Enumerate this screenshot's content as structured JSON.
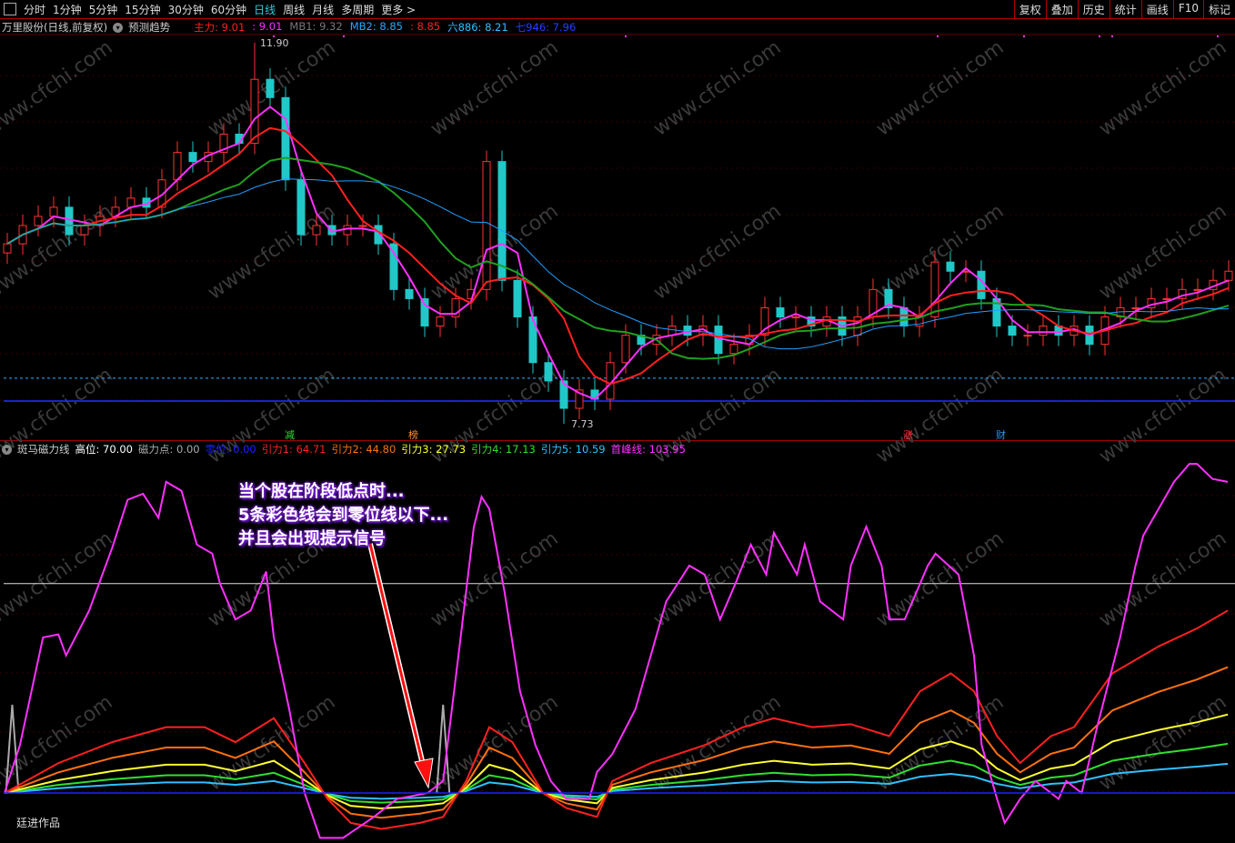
{
  "toolbar": {
    "periods": [
      "分时",
      "1分钟",
      "5分钟",
      "15分钟",
      "30分钟",
      "60分钟",
      "日线",
      "周线",
      "月线",
      "多周期",
      "更多 >"
    ],
    "active": "日线",
    "right": [
      "复权",
      "叠加",
      "历史",
      "统计",
      "画线",
      "F10",
      "标记"
    ]
  },
  "main_legend": {
    "title": "万里股份(日线,前复权)",
    "forecast": "预测趋势",
    "items": [
      {
        "label": "主力: 9.01",
        "color": "#ff2020"
      },
      {
        "label": ": 9.01",
        "color": "#ff30ff"
      },
      {
        "label": "MB1: 9.32",
        "color": "#777777"
      },
      {
        "label": "MB2: 8.85",
        "color": "#20aaff"
      },
      {
        "label": ": 8.85",
        "color": "#ff2020"
      },
      {
        "label": "六886: 8.21",
        "color": "#30c0ff"
      },
      {
        "label": "七946: 7.96",
        "color": "#2040ff"
      }
    ]
  },
  "ind_legend": {
    "title": "斑马磁力线",
    "items": [
      {
        "label": "高位: 70.00",
        "color": "#ffffff"
      },
      {
        "label": "磁力点: 0.00",
        "color": "#aaaaaa"
      },
      {
        "label": "零位: 0.00",
        "color": "#2020ff"
      },
      {
        "label": "引力1: 64.71",
        "color": "#ff2020"
      },
      {
        "label": "引力2: 44.80",
        "color": "#ff7010"
      },
      {
        "label": "引力3: 27.73",
        "color": "#ffff30"
      },
      {
        "label": "引力4: 17.13",
        "color": "#30e030"
      },
      {
        "label": "引力5: 10.59",
        "color": "#30c0ff"
      },
      {
        "label": "首峰线: 103.95",
        "color": "#ff30ff"
      }
    ]
  },
  "annotation": [
    "当个股在阶段低点时...",
    "5条彩色线会到零位线以下...",
    "并且会出现提示信号"
  ],
  "footer": "廷进作品",
  "watermark": "www.cfchi.com",
  "markers": [
    {
      "label": "减",
      "bar": 37,
      "color": "#30e030"
    },
    {
      "label": "榜",
      "bar": 53,
      "color": "#ff9030"
    },
    {
      "label": "涨",
      "bar": 117,
      "color": "#ff3030"
    },
    {
      "label": "财",
      "bar": 129,
      "color": "#3090ff"
    }
  ],
  "chart_data": [
    {
      "type": "candlestick",
      "title": "万里股份(日线,前复权)",
      "ylim": [
        7.5,
        12.1
      ],
      "high_label": "11.90",
      "low_label": "7.73",
      "high_value": 11.9,
      "low_value": 7.73,
      "high_bar": 16,
      "low_bar": 36,
      "ref_lines": [
        {
          "value": 8.23,
          "style": "dashed",
          "color": "#30b0ff"
        },
        {
          "value": 7.98,
          "style": "solid",
          "color": "#2030ff"
        }
      ],
      "close": [
        9.7,
        9.9,
        10.0,
        10.1,
        9.8,
        9.9,
        10.0,
        10.1,
        10.2,
        10.1,
        10.4,
        10.7,
        10.6,
        10.7,
        10.9,
        10.8,
        11.5,
        11.3,
        10.4,
        9.8,
        9.9,
        9.8,
        9.9,
        9.9,
        9.7,
        9.2,
        9.1,
        8.8,
        8.9,
        9.1,
        9.2,
        10.6,
        9.3,
        8.9,
        8.4,
        8.2,
        7.9,
        8.1,
        8.0,
        8.4,
        8.7,
        8.6,
        8.7,
        8.8,
        8.7,
        8.8,
        8.5,
        8.6,
        8.7,
        9.0,
        8.9,
        8.9,
        8.8,
        8.9,
        8.7,
        8.9,
        9.2,
        9.0,
        8.8,
        8.9,
        9.5,
        9.4,
        9.4,
        9.1,
        8.8,
        8.7,
        8.7,
        8.8,
        8.7,
        8.8,
        8.6,
        8.9,
        9.0,
        9.0,
        9.1,
        9.1,
        9.2,
        9.2,
        9.3,
        9.4
      ],
      "ma": [
        {
          "period": 3,
          "color": "#ff30ff"
        },
        {
          "period": 6,
          "color": "#ff2020"
        },
        {
          "period": 12,
          "color": "#20a020"
        },
        {
          "period": 18,
          "color": "#20a0ff"
        }
      ]
    },
    {
      "type": "line",
      "title": "斑马磁力线",
      "ylim": [
        -20,
        115
      ],
      "high_level": 70,
      "zero_level": 0,
      "bars": 160,
      "series": [
        {
          "name": "首峰线",
          "color": "#ff30ff",
          "points": [
            [
              0,
              0
            ],
            [
              2,
              16
            ],
            [
              5,
              52
            ],
            [
              7,
              53
            ],
            [
              8,
              46
            ],
            [
              11,
              61
            ],
            [
              14,
              82
            ],
            [
              16,
              98
            ],
            [
              18,
              100
            ],
            [
              20,
              92
            ],
            [
              21,
              104
            ],
            [
              23,
              101
            ],
            [
              25,
              83
            ],
            [
              27,
              80
            ],
            [
              28,
              70
            ],
            [
              30,
              58
            ],
            [
              32,
              61
            ],
            [
              34,
              74
            ],
            [
              35,
              52
            ],
            [
              37,
              28
            ],
            [
              39,
              0
            ],
            [
              41,
              -15
            ],
            [
              44,
              -15
            ],
            [
              48,
              -8
            ],
            [
              51,
              -2
            ],
            [
              55,
              0
            ],
            [
              57,
              4
            ],
            [
              59,
              46
            ],
            [
              61,
              89
            ],
            [
              62,
              99
            ],
            [
              63,
              95
            ],
            [
              65,
              67
            ],
            [
              67,
              34
            ],
            [
              69,
              16
            ],
            [
              71,
              4
            ],
            [
              73,
              -2
            ],
            [
              76,
              -2
            ],
            [
              77,
              7
            ],
            [
              79,
              13
            ],
            [
              82,
              28
            ],
            [
              84,
              46
            ],
            [
              86,
              64
            ],
            [
              89,
              76
            ],
            [
              91,
              73
            ],
            [
              93,
              58
            ],
            [
              95,
              70
            ],
            [
              97,
              83
            ],
            [
              99,
              73
            ],
            [
              100,
              87
            ],
            [
              103,
              73
            ],
            [
              104,
              83
            ],
            [
              106,
              64
            ],
            [
              109,
              58
            ],
            [
              110,
              76
            ],
            [
              112,
              89
            ],
            [
              114,
              76
            ],
            [
              115,
              58
            ],
            [
              117,
              58
            ],
            [
              120,
              76
            ],
            [
              121,
              80
            ],
            [
              124,
              73
            ],
            [
              126,
              46
            ],
            [
              127,
              16
            ],
            [
              129,
              -2
            ],
            [
              130,
              -10
            ],
            [
              132,
              -2
            ],
            [
              134,
              4
            ],
            [
              137,
              -2
            ],
            [
              138,
              4
            ],
            [
              140,
              0
            ],
            [
              142,
              22
            ],
            [
              145,
              52
            ],
            [
              147,
              76
            ],
            [
              148,
              86
            ],
            [
              150,
              95
            ],
            [
              152,
              104
            ],
            [
              154,
              110
            ],
            [
              155,
              110
            ],
            [
              157,
              105
            ],
            [
              159,
              104
            ]
          ]
        },
        {
          "name": "引力1",
          "color": "#ff2020",
          "points": [
            [
              0,
              0
            ],
            [
              7,
              10
            ],
            [
              14,
              17
            ],
            [
              21,
              22
            ],
            [
              26,
              22
            ],
            [
              30,
              17
            ],
            [
              35,
              25
            ],
            [
              39,
              10
            ],
            [
              42,
              -2
            ],
            [
              45,
              -10
            ],
            [
              49,
              -12
            ],
            [
              54,
              -10
            ],
            [
              57,
              -8
            ],
            [
              60,
              4
            ],
            [
              63,
              22
            ],
            [
              66,
              17
            ],
            [
              70,
              0
            ],
            [
              73,
              -5
            ],
            [
              77,
              -8
            ],
            [
              79,
              4
            ],
            [
              84,
              10
            ],
            [
              91,
              16
            ],
            [
              96,
              22
            ],
            [
              100,
              25
            ],
            [
              105,
              22
            ],
            [
              110,
              23
            ],
            [
              115,
              19
            ],
            [
              119,
              34
            ],
            [
              123,
              40
            ],
            [
              126,
              34
            ],
            [
              129,
              19
            ],
            [
              132,
              10
            ],
            [
              136,
              19
            ],
            [
              139,
              22
            ],
            [
              144,
              40
            ],
            [
              150,
              49
            ],
            [
              155,
              55
            ],
            [
              159,
              61
            ]
          ]
        }
      ],
      "ratios": [
        {
          "name": "引力2",
          "color": "#ff7010",
          "k": 0.69
        },
        {
          "name": "引力3",
          "color": "#ffff30",
          "k": 0.43
        },
        {
          "name": "引力4",
          "color": "#30e030",
          "k": 0.27
        },
        {
          "name": "引力5",
          "color": "#30c0ff",
          "k": 0.16
        }
      ],
      "signals": [
        1,
        57
      ]
    }
  ]
}
